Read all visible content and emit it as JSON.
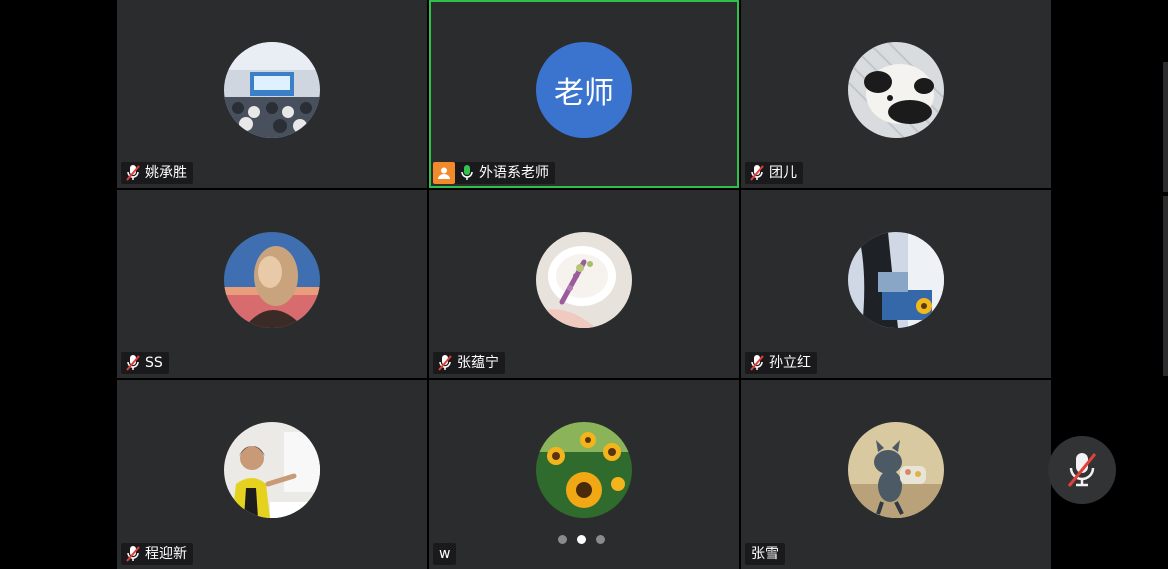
{
  "participants": [
    {
      "name": "姚承胜",
      "muted": true,
      "avatar": "conference-hall-photo"
    },
    {
      "name": "外语系老师",
      "muted": false,
      "host": true,
      "active_speaker": true,
      "avatar": "initials",
      "initials": "老师",
      "avatar_color": "#3a74cf"
    },
    {
      "name": "团儿",
      "muted": true,
      "avatar": "panda-photo"
    },
    {
      "name": "SS",
      "muted": true,
      "avatar": "portrait-photo"
    },
    {
      "name": "张蕴宁",
      "muted": true,
      "avatar": "cake-photo"
    },
    {
      "name": "孙立红",
      "muted": true,
      "avatar": "girl-with-book-photo"
    },
    {
      "name": "程迎新",
      "muted": true,
      "avatar": "speaker-photo"
    },
    {
      "name": "w",
      "muted": null,
      "avatar": "sunflower-photo"
    },
    {
      "name": "张雪",
      "muted": null,
      "avatar": "cartoon-cat-photo"
    }
  ],
  "pager": {
    "page_count": 3,
    "current_page": 2
  },
  "colors": {
    "tile_bg": "#2b2c2e",
    "active_border": "#2fbf4a",
    "muted_red": "#e0413a",
    "mic_green": "#35c34f",
    "host_badge": "#f08a2a",
    "initials_bg": "#3a74cf"
  },
  "self_mic": {
    "state": "muted",
    "icon": "mic-muted-icon"
  }
}
